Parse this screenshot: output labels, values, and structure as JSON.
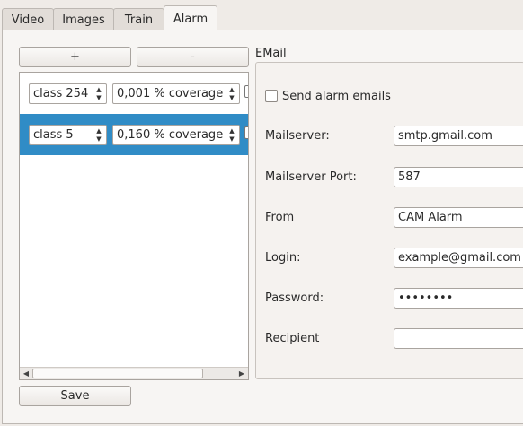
{
  "tabs": [
    {
      "label": "Video"
    },
    {
      "label": "Images"
    },
    {
      "label": "Train"
    },
    {
      "label": "Alarm",
      "active": true
    }
  ],
  "alarm": {
    "add_label": "+",
    "remove_label": "-",
    "save_label": "Save",
    "list": [
      {
        "class_value": "class 254",
        "coverage_value": "0,001 % coverage",
        "selected": false
      },
      {
        "class_value": "class 5",
        "coverage_value": "0,160 % coverage",
        "selected": true
      }
    ],
    "scroll_left_icon": "left-arrow-icon",
    "scroll_right_icon": "right-arrow-icon"
  },
  "email": {
    "group_title": "EMail",
    "send_alarm_label": "Send alarm emails",
    "send_alarm_checked": false,
    "mailserver_label": "Mailserver:",
    "mailserver_value": "smtp.gmail.com",
    "port_label": "Mailserver Port:",
    "port_value": "587",
    "from_label": "From",
    "from_value": "CAM Alarm",
    "login_label": "Login:",
    "login_value": "example@gmail.com",
    "password_label": "Password:",
    "password_value": "••••••••",
    "recipient_label": "Recipient",
    "recipient_value": ""
  },
  "colors": {
    "selection": "#308cc6"
  }
}
